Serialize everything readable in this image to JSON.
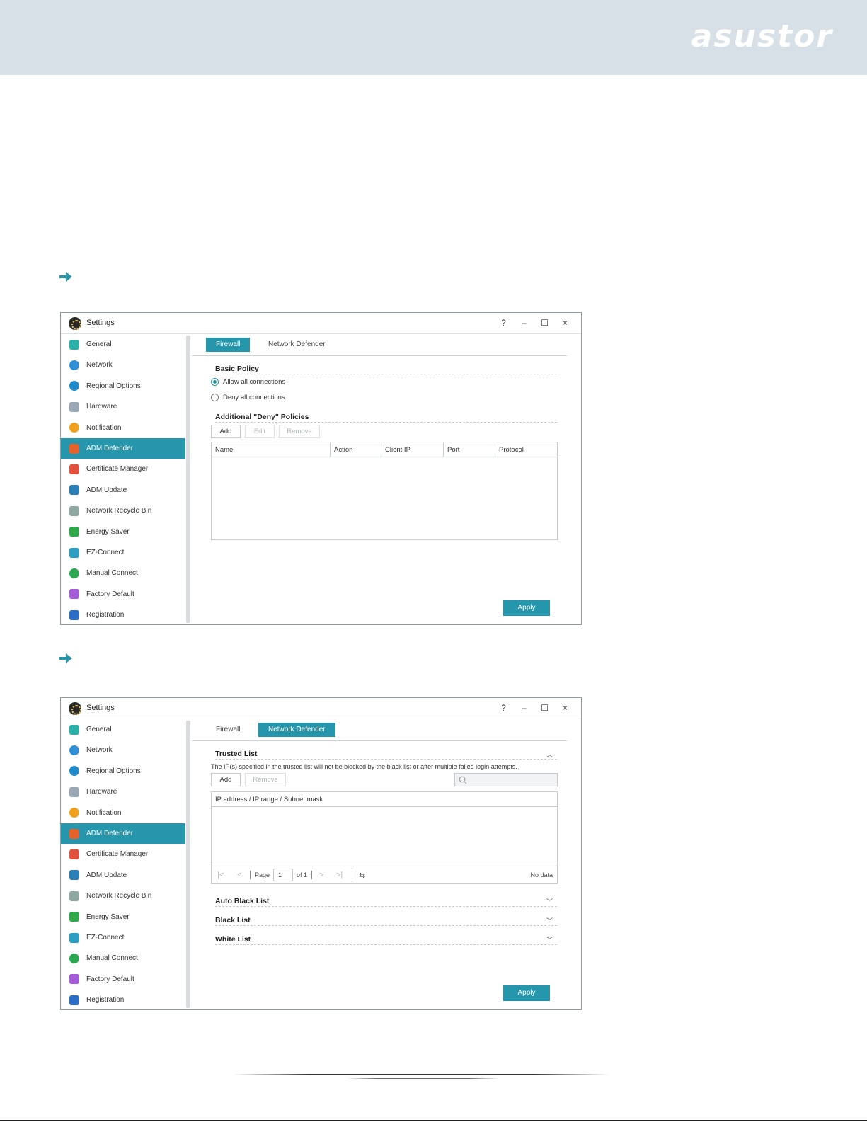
{
  "header": {
    "brand": "asustor"
  },
  "colors": {
    "accent": "#2596ab",
    "header_bg": "#d6e0e6"
  },
  "window_common": {
    "title": "Settings",
    "controls": {
      "help": "?",
      "minimize": "–",
      "maximize": "☐",
      "close": "×"
    },
    "sidebar": [
      {
        "label": "General",
        "icon": "general-icon",
        "color": "#2ab0a6"
      },
      {
        "label": "Network",
        "icon": "globe-icon",
        "color": "#2f8fd6"
      },
      {
        "label": "Regional Options",
        "icon": "regional-options-icon",
        "color": "#1e88c8"
      },
      {
        "label": "Hardware",
        "icon": "hardware-icon",
        "color": "#9aa7b4"
      },
      {
        "label": "Notification",
        "icon": "notification-icon",
        "color": "#f2a11c"
      },
      {
        "label": "ADM Defender",
        "icon": "adm-defender-icon",
        "color": "#e5622d"
      },
      {
        "label": "Certificate Manager",
        "icon": "certificate-icon",
        "color": "#e2503e"
      },
      {
        "label": "ADM Update",
        "icon": "adm-update-icon",
        "color": "#2d7fb8"
      },
      {
        "label": "Network Recycle Bin",
        "icon": "recycle-bin-icon",
        "color": "#8fa8a1"
      },
      {
        "label": "Energy Saver",
        "icon": "energy-saver-icon",
        "color": "#2fa84a"
      },
      {
        "label": "EZ-Connect",
        "icon": "cloud-upload-icon",
        "color": "#2e9fc2"
      },
      {
        "label": "Manual Connect",
        "icon": "manual-connect-icon",
        "color": "#2ba84f"
      },
      {
        "label": "Factory Default",
        "icon": "undo-icon",
        "color": "#a65bd6"
      },
      {
        "label": "Registration",
        "icon": "registration-icon",
        "color": "#2b6ec4"
      }
    ],
    "tabs": {
      "firewall": "Firewall",
      "network_defender": "Network Defender"
    },
    "apply": "Apply"
  },
  "firewall": {
    "basic_policy": "Basic Policy",
    "allow_all": "Allow all connections",
    "deny_all": "Deny all connections",
    "selected_policy": "allow",
    "deny_policies_title": "Additional \"Deny\" Policies",
    "buttons": {
      "add": "Add",
      "edit": "Edit",
      "remove": "Remove"
    },
    "columns": [
      "Name",
      "Action",
      "Client IP",
      "Port",
      "Protocol"
    ]
  },
  "network_defender": {
    "trusted_list": "Trusted List",
    "note": "The IP(s) specified in the trusted list will not be blocked by the black list or after multiple failed login attempts.",
    "buttons": {
      "add": "Add",
      "remove": "Remove"
    },
    "column": "IP address / IP range / Subnet mask",
    "pager": {
      "page_label": "Page",
      "page_value": "1",
      "of": "of 1",
      "status": "No data"
    },
    "sections": [
      "Auto Black List",
      "Black List",
      "White List"
    ]
  }
}
